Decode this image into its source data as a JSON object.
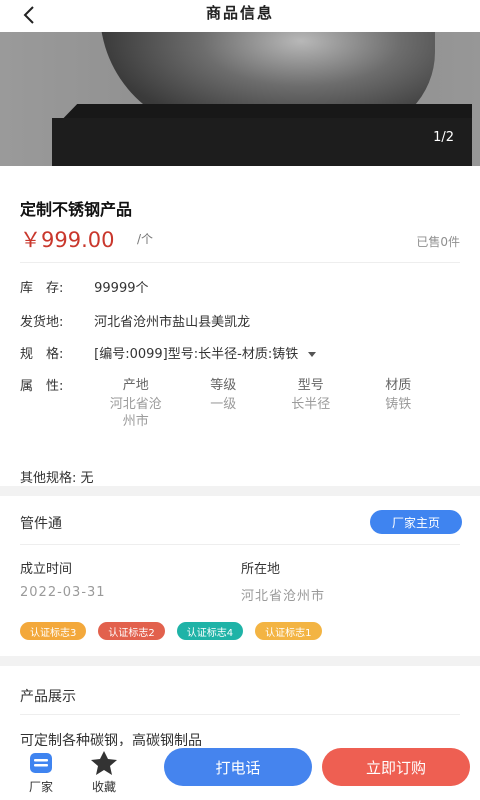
{
  "header": {
    "title": "商品信息"
  },
  "gallery": {
    "counter": "1/2"
  },
  "product": {
    "title": "定制不锈钢产品",
    "price": "￥999.00",
    "unit": "/个",
    "sold": "已售0件"
  },
  "info": {
    "stock_label": "库　存:",
    "stock_value": "99999个",
    "ship_label": "发货地:",
    "ship_value": "河北省沧州市盐山县美凯龙",
    "spec_label": "规　格:",
    "spec_value": "[编号:0099]型号:长半径-材质:铸铁",
    "attr_label": "属　性:",
    "attr_headers": [
      "产地",
      "等级",
      "型号",
      "材质"
    ],
    "attr_values": [
      "河北省沧州市",
      "一级",
      "长半径",
      "铸铁"
    ],
    "other_specs": "其他规格: 无"
  },
  "maker": {
    "name": "管件通",
    "home_button": "厂家主页",
    "founded_label": "成立时间",
    "founded_value": "2022-03-31",
    "location_label": "所在地",
    "location_value": "河北省沧州市",
    "badges": [
      {
        "label": "认证标志3",
        "color": "#f3a83b"
      },
      {
        "label": "认证标志2",
        "color": "#e2614d"
      },
      {
        "label": "认证标志4",
        "color": "#1fb3a7"
      },
      {
        "label": "认证标志1",
        "color": "#f3b443"
      }
    ]
  },
  "showcase": {
    "title": "产品展示",
    "text": "可定制各种碳钢，高碳钢制品"
  },
  "bottom_bar": {
    "factory_label": "厂家",
    "favorite_label": "收藏",
    "call_label": "打电话",
    "order_label": "立即订购"
  },
  "colors": {
    "price": "#c9372c",
    "primary_blue": "#4584ee",
    "order_red": "#ee5f52"
  },
  "icons": [
    "back-arrow-icon",
    "factory-icon",
    "star-icon",
    "caret-down-icon"
  ]
}
